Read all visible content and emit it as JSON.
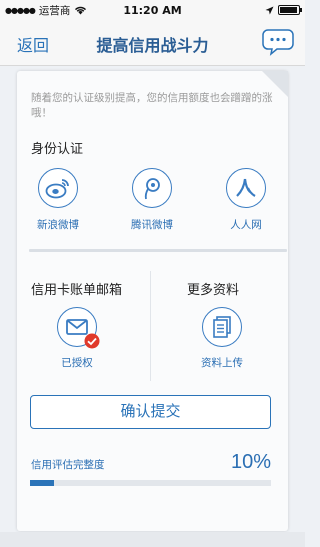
{
  "status_bar": {
    "carrier": "运营商",
    "time": "11:20 AM"
  },
  "nav": {
    "back_label": "返回",
    "title": "提高信用战斗力"
  },
  "intro_text": "随着您的认证级别提高，您的信用额度也会蹭蹭的涨哦！",
  "identity": {
    "title": "身份认证",
    "items": [
      {
        "label": "新浪微博",
        "icon": "weibo-icon"
      },
      {
        "label": "腾讯微博",
        "icon": "tencent-weibo-icon"
      },
      {
        "label": "人人网",
        "icon": "renren-icon"
      }
    ]
  },
  "mailbox": {
    "title": "信用卡账单邮箱",
    "status": "已授权",
    "icon": "mail-icon"
  },
  "more_info": {
    "title": "更多资料",
    "action": "资料上传",
    "icon": "document-icon"
  },
  "submit_label": "确认提交",
  "evaluation": {
    "label": "信用评估完整度",
    "value_text": "10%",
    "progress": 0.1
  },
  "colors": {
    "accent": "#2a73b8",
    "badge": "#e0392b"
  }
}
